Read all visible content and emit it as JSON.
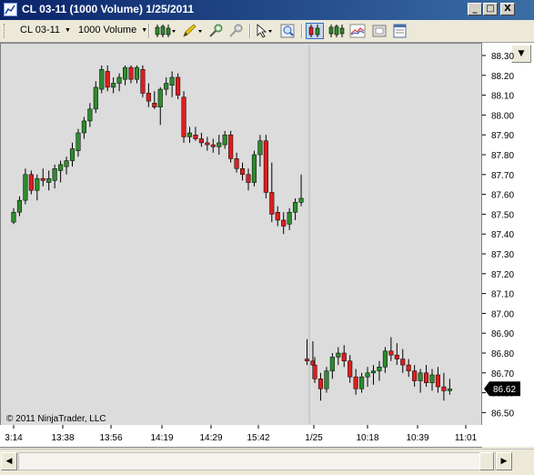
{
  "window": {
    "title": "CL 03-11 (1000 Volume)  1/25/2011",
    "min_label": "_",
    "max_label": "□",
    "close_label": "X"
  },
  "toolbar": {
    "instrument": "CL 03-11",
    "period": "1000 Volume",
    "icons": [
      "candlestick-style-icon",
      "pencil-draw-icon",
      "zoom-in-icon",
      "zoom-out-icon",
      "pointer-icon",
      "magnifier-icon",
      "data-series-icon",
      "indicators-icon",
      "strategies-icon",
      "properties-icon"
    ]
  },
  "colors": {
    "up": "#2e8b2e",
    "down": "#dc1e1e",
    "background": "#dcdcdc",
    "wick": "#000000"
  },
  "copyright": "© 2011 NinjaTrader, LLC",
  "price_badge": "86.62",
  "chart_data": {
    "type": "candlestick",
    "y_ticks": [
      "88.30",
      "88.20",
      "88.10",
      "88.00",
      "87.90",
      "87.80",
      "87.70",
      "87.60",
      "87.50",
      "87.40",
      "87.30",
      "87.20",
      "87.10",
      "87.00",
      "86.90",
      "86.80",
      "86.70",
      "86.60",
      "86.50"
    ],
    "x_ticks": [
      "3:14",
      "13:38",
      "13:56",
      "14:19",
      "14:29",
      "15:42",
      "1/25",
      "10:18",
      "10:39",
      "11:01"
    ],
    "ylim": [
      86.45,
      88.33
    ],
    "last_price": 86.62,
    "session_break_index": 52,
    "bars": [
      [
        87.46,
        87.53,
        87.45,
        87.51
      ],
      [
        87.51,
        87.59,
        87.49,
        87.57
      ],
      [
        87.57,
        87.73,
        87.55,
        87.7
      ],
      [
        87.7,
        87.72,
        87.6,
        87.62
      ],
      [
        87.62,
        87.7,
        87.57,
        87.68
      ],
      [
        87.68,
        87.73,
        87.64,
        87.67
      ],
      [
        87.66,
        87.72,
        87.62,
        87.68
      ],
      [
        87.67,
        87.75,
        87.63,
        87.73
      ],
      [
        87.72,
        87.77,
        87.66,
        87.75
      ],
      [
        87.74,
        87.79,
        87.7,
        87.77
      ],
      [
        87.77,
        87.86,
        87.74,
        87.83
      ],
      [
        87.82,
        87.93,
        87.79,
        87.91
      ],
      [
        87.91,
        87.99,
        87.88,
        87.97
      ],
      [
        87.97,
        88.06,
        87.94,
        88.03
      ],
      [
        88.03,
        88.17,
        88.01,
        88.14
      ],
      [
        88.13,
        88.25,
        88.11,
        88.23
      ],
      [
        88.22,
        88.25,
        88.12,
        88.14
      ],
      [
        88.14,
        88.19,
        88.11,
        88.16
      ],
      [
        88.16,
        88.21,
        88.12,
        88.19
      ],
      [
        88.18,
        88.25,
        88.15,
        88.24
      ],
      [
        88.24,
        88.25,
        88.16,
        88.18
      ],
      [
        88.18,
        88.25,
        88.16,
        88.24
      ],
      [
        88.23,
        88.25,
        88.09,
        88.11
      ],
      [
        88.11,
        88.16,
        88.04,
        88.07
      ],
      [
        88.06,
        88.12,
        88.03,
        88.04
      ],
      [
        88.04,
        88.14,
        87.95,
        88.13
      ],
      [
        88.13,
        88.19,
        88.1,
        88.16
      ],
      [
        88.15,
        88.22,
        88.09,
        88.19
      ],
      [
        88.19,
        88.21,
        88.08,
        88.1
      ],
      [
        88.09,
        88.12,
        87.86,
        87.89
      ],
      [
        87.89,
        87.94,
        87.86,
        87.91
      ],
      [
        87.9,
        87.94,
        87.87,
        87.88
      ],
      [
        87.88,
        87.91,
        87.84,
        87.86
      ],
      [
        87.86,
        87.89,
        87.82,
        87.85
      ],
      [
        87.85,
        87.88,
        87.81,
        87.84
      ],
      [
        87.84,
        87.9,
        87.8,
        87.86
      ],
      [
        87.85,
        87.92,
        87.83,
        87.9
      ],
      [
        87.9,
        87.92,
        87.76,
        87.78
      ],
      [
        87.78,
        87.81,
        87.71,
        87.73
      ],
      [
        87.73,
        87.76,
        87.67,
        87.7
      ],
      [
        87.7,
        87.73,
        87.62,
        87.66
      ],
      [
        87.66,
        87.82,
        87.64,
        87.8
      ],
      [
        87.8,
        87.9,
        87.74,
        87.87
      ],
      [
        87.87,
        87.9,
        87.58,
        87.61
      ],
      [
        87.61,
        87.76,
        87.46,
        87.5
      ],
      [
        87.51,
        87.54,
        87.44,
        87.47
      ],
      [
        87.47,
        87.51,
        87.4,
        87.44
      ],
      [
        87.45,
        87.53,
        87.42,
        87.51
      ],
      [
        87.51,
        87.58,
        87.47,
        87.56
      ],
      [
        87.56,
        87.7,
        87.54,
        87.58
      ],
      [
        86.77,
        86.87,
        86.74,
        86.76
      ],
      [
        86.76,
        86.86,
        86.73,
        86.74
      ],
      [
        86.74,
        86.78,
        86.65,
        86.67
      ],
      [
        86.67,
        86.7,
        86.56,
        86.62
      ],
      [
        86.62,
        86.73,
        86.6,
        86.71
      ],
      [
        86.71,
        86.8,
        86.67,
        86.78
      ],
      [
        86.78,
        86.83,
        86.74,
        86.8
      ],
      [
        86.8,
        86.84,
        86.73,
        86.76
      ],
      [
        86.76,
        86.79,
        86.65,
        86.68
      ],
      [
        86.68,
        86.72,
        86.59,
        86.62
      ],
      [
        86.62,
        86.7,
        86.6,
        86.68
      ],
      [
        86.68,
        86.73,
        86.63,
        86.7
      ],
      [
        86.7,
        86.74,
        86.64,
        86.71
      ],
      [
        86.71,
        86.76,
        86.66,
        86.73
      ],
      [
        86.73,
        86.83,
        86.7,
        86.81
      ],
      [
        86.81,
        86.88,
        86.76,
        86.79
      ],
      [
        86.79,
        86.85,
        86.74,
        86.77
      ],
      [
        86.77,
        86.82,
        86.7,
        86.74
      ],
      [
        86.74,
        86.77,
        86.68,
        86.71
      ],
      [
        86.71,
        86.74,
        86.63,
        86.66
      ],
      [
        86.66,
        86.72,
        86.6,
        86.7
      ],
      [
        86.7,
        86.74,
        86.63,
        86.65
      ],
      [
        86.65,
        86.72,
        86.61,
        86.69
      ],
      [
        86.69,
        86.73,
        86.6,
        86.63
      ],
      [
        86.63,
        86.7,
        86.56,
        86.61
      ],
      [
        86.61,
        86.67,
        86.59,
        86.62
      ]
    ]
  }
}
